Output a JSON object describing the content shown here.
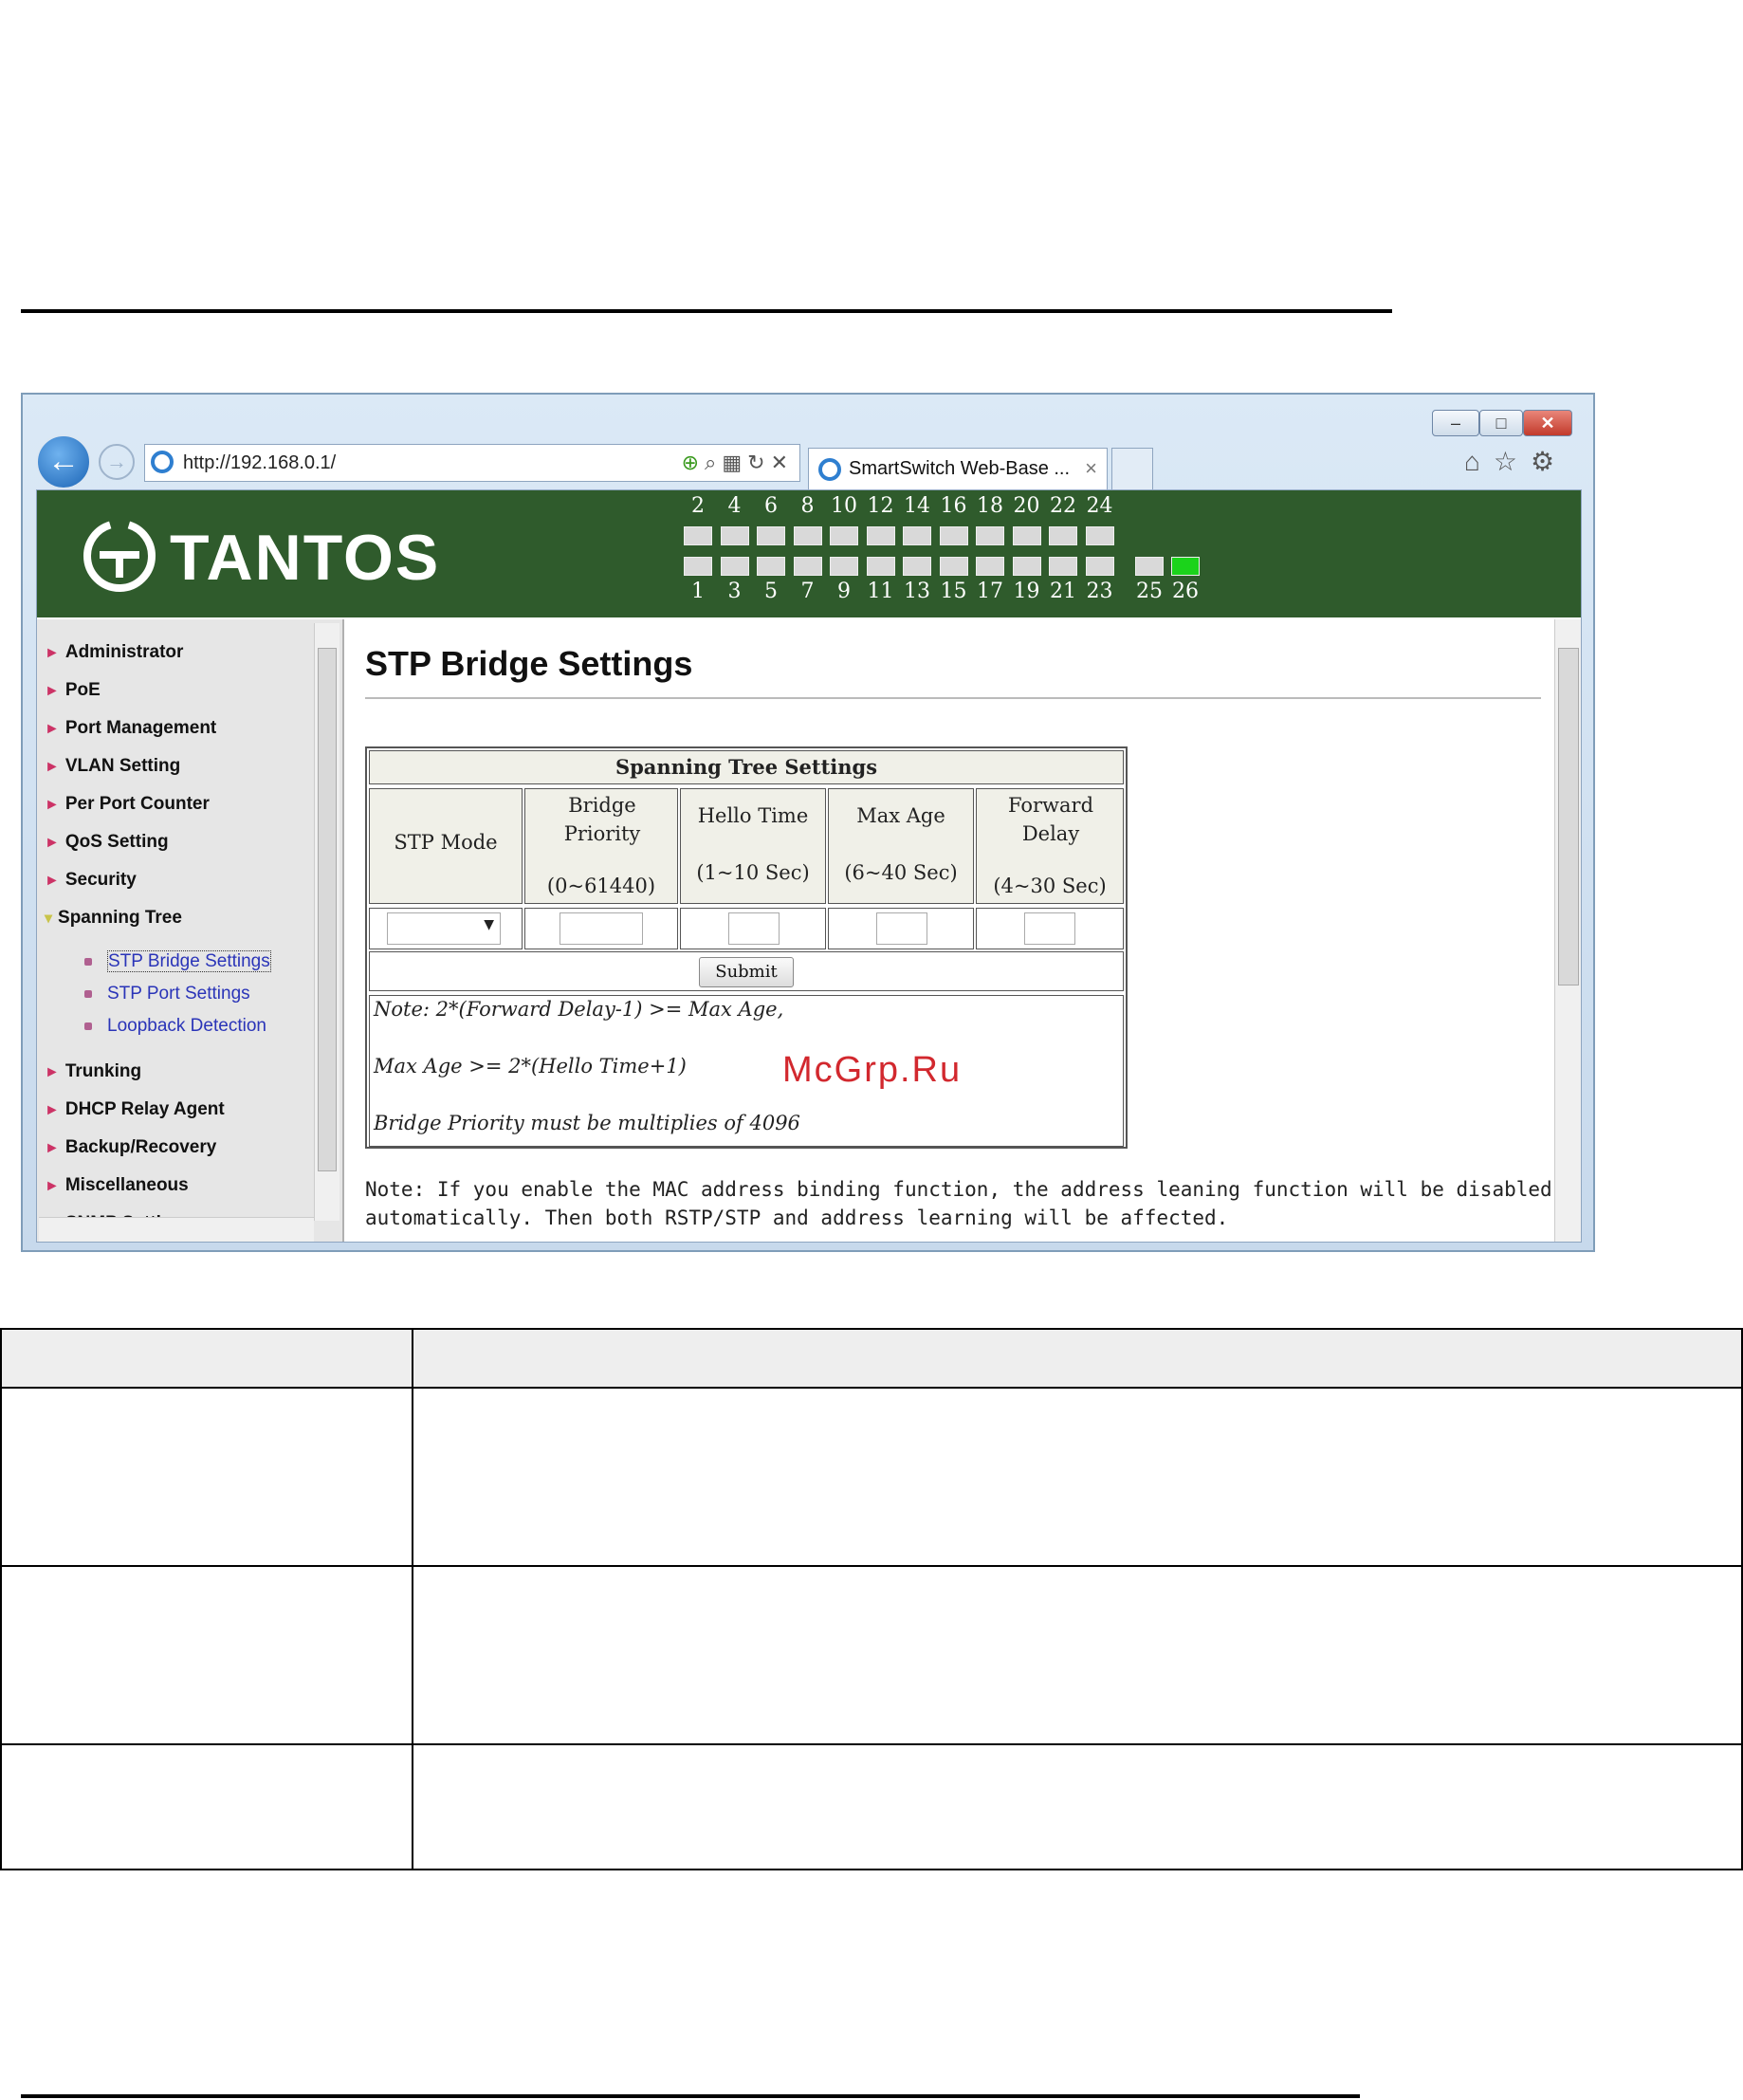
{
  "browser": {
    "url": "http://192.168.0.1/",
    "tab_title": "SmartSwitch Web-Base ...",
    "tab_close": "×",
    "window_min": "–",
    "window_max": "□",
    "window_close": "✕",
    "back": "←",
    "forward": "→",
    "icons": [
      "add-icon",
      "search-icon",
      "compatibility-icon",
      "refresh-icon",
      "stop-icon",
      "home-icon",
      "favorites-icon",
      "tools-gear-icon"
    ]
  },
  "header": {
    "logo_text": "TANTOS",
    "banner_color": "#2f5b2c",
    "ports_top": [
      "2",
      "4",
      "6",
      "8",
      "10",
      "12",
      "14",
      "16",
      "18",
      "20",
      "22",
      "24"
    ],
    "ports_bottom": [
      "1",
      "3",
      "5",
      "7",
      "9",
      "11",
      "13",
      "15",
      "17",
      "19",
      "21",
      "23"
    ],
    "uplinks": [
      "25",
      "26"
    ],
    "active_port": "26",
    "active_color": "#1bd31b"
  },
  "sidebar": {
    "items": [
      {
        "label": "Administrator"
      },
      {
        "label": "PoE"
      },
      {
        "label": "Port Management"
      },
      {
        "label": "VLAN Setting"
      },
      {
        "label": "Per Port Counter"
      },
      {
        "label": "QoS Setting"
      },
      {
        "label": "Security"
      },
      {
        "label": "Spanning Tree"
      },
      {
        "label": "Trunking"
      },
      {
        "label": "DHCP Relay Agent"
      },
      {
        "label": "Backup/Recovery"
      },
      {
        "label": "Miscellaneous"
      },
      {
        "label": "SNMP Settings"
      }
    ],
    "subitems": [
      {
        "label": "STP Bridge Settings"
      },
      {
        "label": "STP Port Settings"
      },
      {
        "label": "Loopback Detection"
      }
    ]
  },
  "main": {
    "title": "STP Bridge Settings",
    "table_title": "Spanning Tree Settings",
    "columns": [
      {
        "name": "STP Mode",
        "range": ""
      },
      {
        "name": "Bridge Priority",
        "range": "(0~61440)"
      },
      {
        "name": "Hello Time",
        "range": "(1~10 Sec)"
      },
      {
        "name": "Max Age",
        "range": "(6~40 Sec)"
      },
      {
        "name": "Forward Delay",
        "range": "(4~30 Sec)"
      }
    ],
    "submit_label": "Submit",
    "notes": [
      "Note: 2*(Forward Delay-1) >= Max Age,",
      "Max Age >= 2*(Hello Time+1)",
      "Bridge Priority must be multiplies of 4096"
    ],
    "mac_note": "Note: If you enable the MAC address binding function, the address leaning function will be disabled automatically. Then both RSTP/STP and address learning will be affected.",
    "watermark": "McGrp.Ru"
  }
}
